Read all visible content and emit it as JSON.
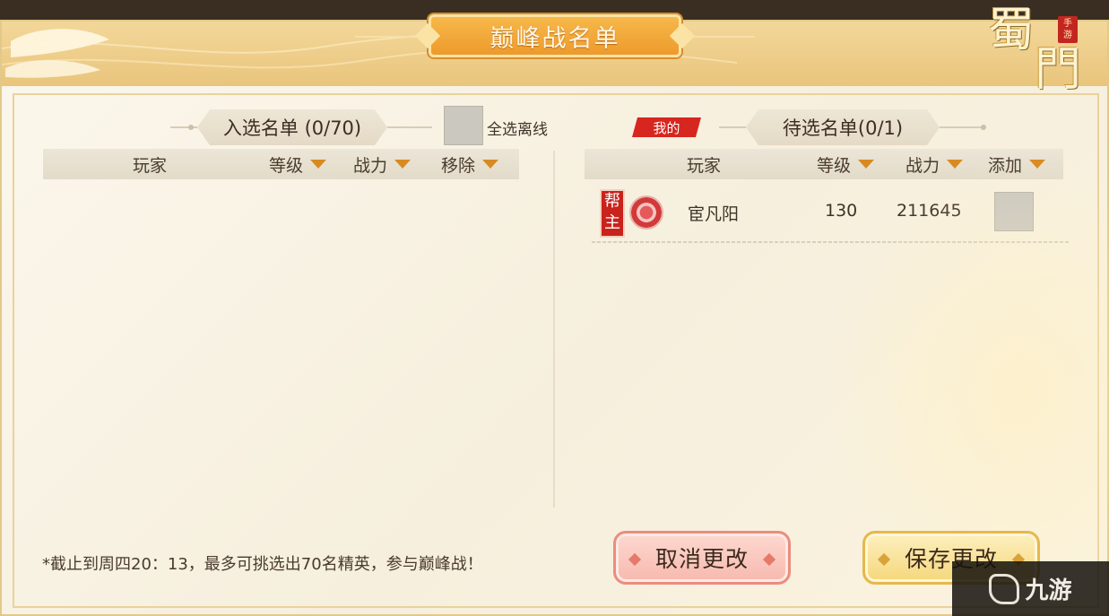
{
  "window": {
    "title": "巅峰战名单",
    "logo_text": "蜀門",
    "logo_seal": "手游"
  },
  "selected_list": {
    "title": "入选名单 (0/70)",
    "select_offline_label": "全选离线",
    "columns": [
      "玩家",
      "等级",
      "战力",
      "移除"
    ],
    "rows": []
  },
  "pending_list": {
    "mine_tag": "我的",
    "title": "待选名单(0/1)",
    "columns": [
      "玩家",
      "等级",
      "战力",
      "添加"
    ],
    "rows": [
      {
        "role": "帮主",
        "name": "宦凡阳",
        "level": "130",
        "power": "211645"
      }
    ]
  },
  "footer": {
    "note": "*截止到周四20：13，最多可挑选出70名精英，参与巅峰战！",
    "cancel_label": "取消更改",
    "save_label": "保存更改"
  },
  "watermark": {
    "text": "九游"
  },
  "colors": {
    "accent_orange": "#ee9a2c",
    "mine_tag_red": "#d7261f",
    "caret": "#d88a22",
    "cancel_button": "#f7b9ae",
    "save_button": "#f5d77b"
  }
}
